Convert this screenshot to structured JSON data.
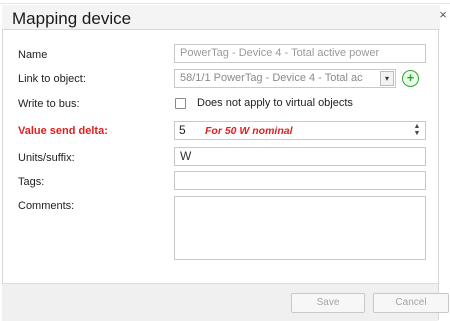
{
  "dialog": {
    "title": "Mapping device",
    "close_glyph": "×",
    "close_icon": "close-icon"
  },
  "form": {
    "name": {
      "label": "Name",
      "value": "PowerTag - Device 4 - Total active power"
    },
    "link_to_object": {
      "label": "Link to object:",
      "value": "58/1/1 PowerTag - Device 4 - Total ac",
      "dropdown_glyph": "▾",
      "add_glyph": "+",
      "add_icon": "add-circle-icon"
    },
    "write_to_bus": {
      "label": "Write to bus:",
      "checkbox_checked": false,
      "checkbox_label": "Does not apply to virtual objects"
    },
    "value_send_delta": {
      "label": "Value send delta:",
      "value": "5",
      "hint": "For 50 W nominal",
      "arrow_up": "▲",
      "arrow_down": "▼"
    },
    "units_suffix": {
      "label": "Units/suffix:",
      "value": "W"
    },
    "tags": {
      "label": "Tags:",
      "value": ""
    },
    "comments": {
      "label": "Comments:",
      "value": ""
    }
  },
  "footer": {
    "save_label": "Save",
    "cancel_label": "Cancel"
  },
  "colors": {
    "required_label": "#e02020",
    "add_button": "#2fa52f",
    "footer_bg": "#f0f0f0"
  }
}
